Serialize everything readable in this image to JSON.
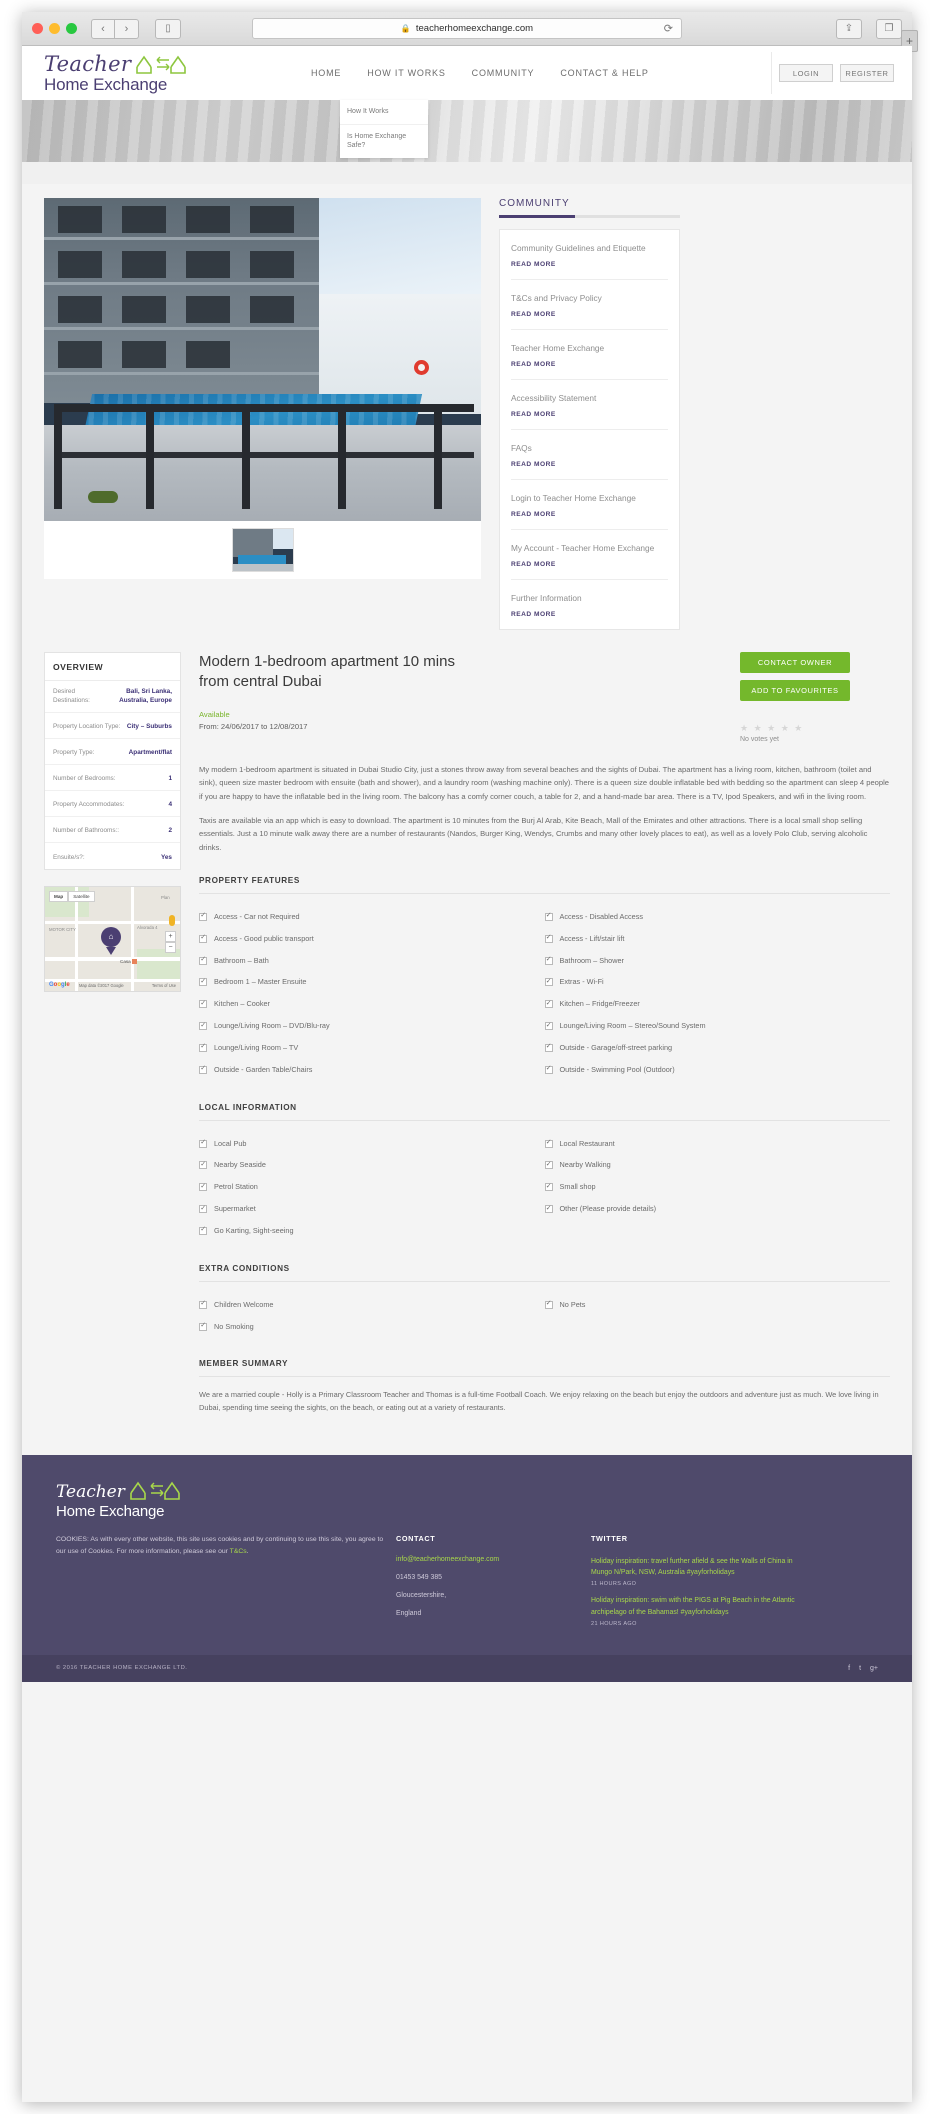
{
  "browser": {
    "url": "teacherhomeexchange.com",
    "lock_icon": "lock-icon",
    "reload_icon": "reload-icon",
    "back_label": "‹",
    "forward_label": "›",
    "sidebar_icon": "sidebar-icon",
    "share_icon": "share-icon",
    "tabs_icon": "tabs-icon",
    "new_tab_label": "+"
  },
  "header": {
    "logo_word": "Teacher",
    "logo_sub": "Home Exchange",
    "nav": [
      {
        "label": "HOME"
      },
      {
        "label": "HOW IT WORKS"
      },
      {
        "label": "COMMUNITY"
      },
      {
        "label": "CONTACT & HELP"
      }
    ],
    "login_label": "LOGIN",
    "register_label": "REGISTER",
    "dropdown": [
      {
        "label": "How It Works"
      },
      {
        "label": "Is Home Exchange Safe?"
      }
    ]
  },
  "community": {
    "title": "COMMUNITY",
    "read_more": "READ MORE",
    "items": [
      {
        "title": "Community Guidelines and Etiquette"
      },
      {
        "title": "T&Cs and Privacy Policy"
      },
      {
        "title": "Teacher Home Exchange"
      },
      {
        "title": "Accessibility Statement"
      },
      {
        "title": "FAQs"
      },
      {
        "title": "Login to Teacher Home Exchange"
      },
      {
        "title": "My Account - Teacher Home Exchange"
      },
      {
        "title": "Further Information"
      }
    ]
  },
  "overview": {
    "heading": "OVERVIEW",
    "rows": [
      {
        "key": "Desired Destinations:",
        "value": "Bali, Sri Lanka, Australia, Europe"
      },
      {
        "key": "Property Location Type:",
        "value": "City – Suburbs"
      },
      {
        "key": "Property Type:",
        "value": "Apartment/flat"
      },
      {
        "key": "Number of Bedrooms:",
        "value": "1"
      },
      {
        "key": "Property Accommodates:",
        "value": "4"
      },
      {
        "key": "Number of Bathrooms::",
        "value": "2"
      },
      {
        "key": "Ensuite/s?:",
        "value": "Yes"
      }
    ]
  },
  "map": {
    "map_button": "Map",
    "satellite_button": "Satellite",
    "zoom_in": "+",
    "zoom_out": "−",
    "label_motor_city": "MOTOR CITY",
    "label_alvorada": "Alvorada 4",
    "label_plan": "Plan",
    "label_casa": "Casa",
    "attribution": "Map data ©2017 Google",
    "terms": "Terms of Use",
    "google_letters": [
      "G",
      "o",
      "o",
      "g",
      "l",
      "e"
    ],
    "pin_icon": "home-pin-icon"
  },
  "listing": {
    "title": "Modern 1-bedroom apartment 10 mins from central Dubai",
    "availability_label": "Available",
    "availability_dates": "From: 24/06/2017 to 12/08/2017",
    "contact_owner_label": "CONTACT OWNER",
    "add_favourites_label": "ADD TO FAVOURITES",
    "rating_stars": "★ ★ ★ ★ ★",
    "rating_text": "No votes yet",
    "description": [
      "My modern 1-bedroom apartment is situated in Dubai Studio City, just a stones throw away from several beaches and the sights of Dubai. The apartment has a living room, kitchen, bathroom (toilet and sink), queen size master bedroom with ensuite (bath and shower), and a laundry room (washing machine only). There is a queen size double inflatable bed with bedding so the apartment can sleep 4 people if you are happy to have the inflatable bed in the living room. The balcony has a comfy corner couch, a table for 2, and a hand-made bar area. There is a TV, Ipod Speakers, and wifi in the living room.",
      "Taxis are available via an app which is easy to download. The apartment is 10 minutes from the Burj Al Arab, Kite Beach, Mall of the Emirates and other attractions. There is a local small shop selling essentials. Just a 10 minute walk away there are a number of restaurants (Nandos, Burger King, Wendys, Crumbs and many other lovely places to eat), as well as a lovely Polo Club, serving alcoholic drinks."
    ]
  },
  "property_features": {
    "heading": "PROPERTY FEATURES",
    "left": [
      "Access - Car not Required",
      "Access - Good public transport",
      "Bathroom – Bath",
      "Bedroom 1 – Master Ensuite",
      "Kitchen – Cooker",
      "Lounge/Living Room – DVD/Blu-ray",
      "Lounge/Living Room – TV",
      "Outside - Garden Table/Chairs"
    ],
    "right": [
      "Access - Disabled Access",
      "Access - Lift/stair lift",
      "Bathroom – Shower",
      "Extras - Wi-Fi",
      "Kitchen – Fridge/Freezer",
      "Lounge/Living Room – Stereo/Sound System",
      "Outside - Garage/off-street parking",
      "Outside - Swimming Pool (Outdoor)"
    ]
  },
  "local_information": {
    "heading": "LOCAL INFORMATION",
    "left": [
      "Local Pub",
      "Nearby Seaside",
      "Petrol Station",
      "Supermarket",
      "Go Karting, Sight-seeing"
    ],
    "right": [
      "Local Restaurant",
      "Nearby Walking",
      "Small shop",
      "Other (Please provide details)"
    ]
  },
  "extra_conditions": {
    "heading": "EXTRA CONDITIONS",
    "left": [
      "Children Welcome",
      "No Smoking"
    ],
    "right": [
      "No Pets"
    ]
  },
  "member_summary": {
    "heading": "MEMBER SUMMARY",
    "text": "We are a married couple - Holly is a Primary Classroom Teacher and Thomas is a full-time Football Coach. We enjoy relaxing on the beach but enjoy the outdoors and adventure just as much. We love living in Dubai, spending time seeing the sights, on the beach, or eating out at a variety of restaurants."
  },
  "footer": {
    "logo_word": "Teacher",
    "logo_sub": "Home Exchange",
    "cookies_text": "COOKIES: As with every other website, this site uses cookies and by continuing to use this site, you agree to our use of Cookies. For more information, please see our ",
    "cookies_link": "T&Cs",
    "cookies_tail": ".",
    "contact_heading": "CONTACT",
    "contact_email": "info@teacherhomeexchange.com",
    "contact_phone": "01453 549 385",
    "contact_county": "Gloucestershire,",
    "contact_country": "England",
    "twitter_heading": "TWITTER",
    "tweets": [
      {
        "text": "Holiday inspiration: travel further afield & see the Walls of China in Mungo N/Park, NSW, Australia #yayforholidays",
        "time": "11 HOURS AGO"
      },
      {
        "text": "Holiday inspiration: swim with the PIGS at Pig Beach in the Atlantic archipelago of the Bahamas! #yayforholidays",
        "time": "21 HOURS AGO"
      }
    ],
    "copyright": "© 2016 TEACHER HOME EXCHANGE LTD.",
    "socials": [
      "f",
      "t",
      "g+"
    ]
  },
  "colors": {
    "brand_purple": "#4b3f72",
    "accent_green": "#74b82c",
    "twitter_green": "#a8d84a",
    "footer_bg": "#4f4a6b"
  }
}
